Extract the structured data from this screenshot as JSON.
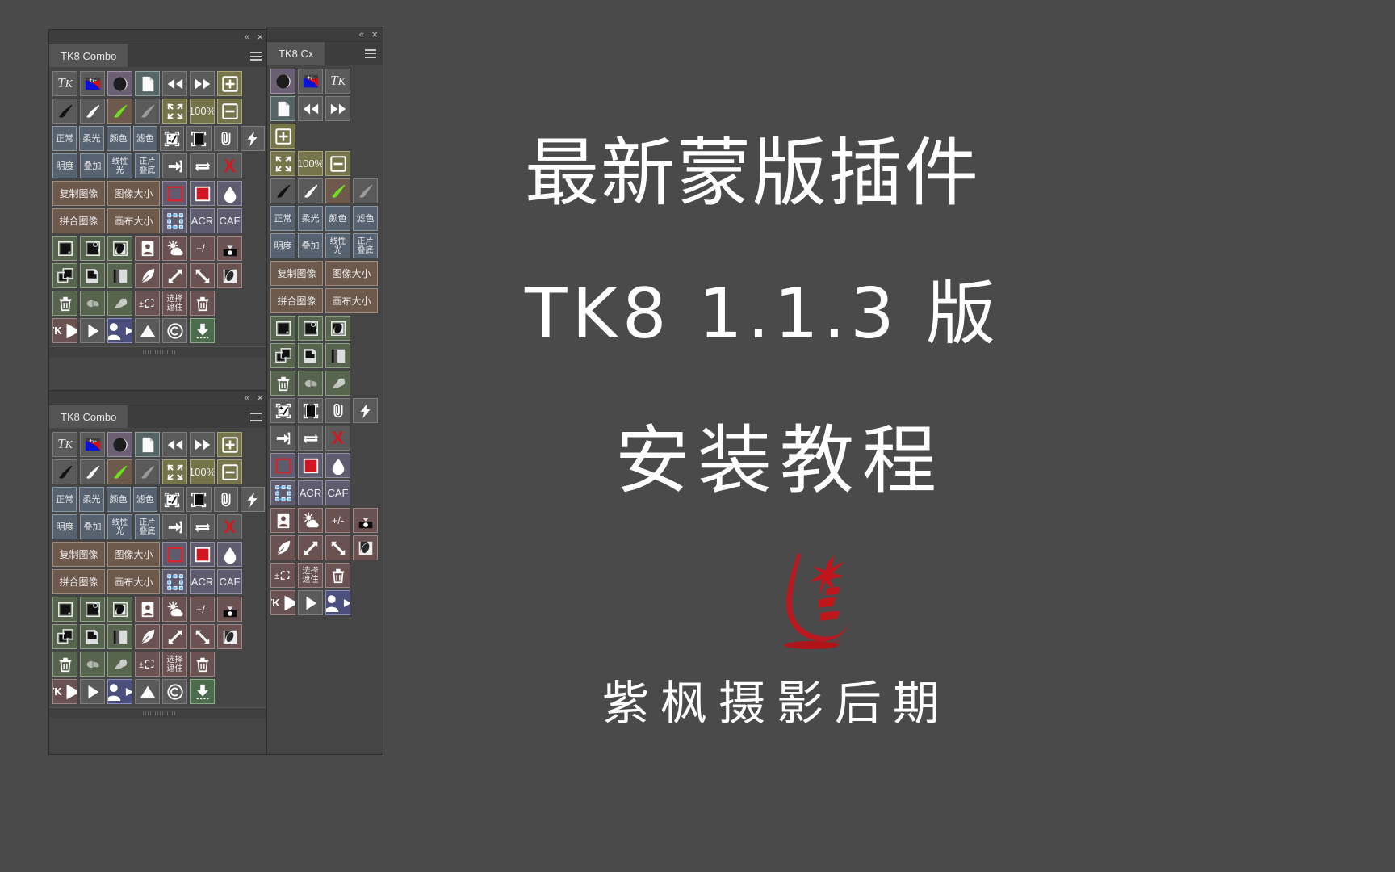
{
  "canvas": {
    "bg": "#4a4a4a"
  },
  "hero": {
    "line1": "最新蒙版插件",
    "line2": "TK8 1.1.3 版",
    "line3": "安装教程",
    "line4": "紫枫摄影后期",
    "logo_label": "紫枫摄影后期 seal",
    "logo_color": "#c0151b"
  },
  "panels": [
    {
      "id": "combo-top",
      "tab_label": "TK8 Combo",
      "collapse_label": "«",
      "close_label": "×",
      "menu_label": "panel-menu"
    },
    {
      "id": "cx",
      "tab_label": "TK8 Cx",
      "collapse_label": "«",
      "close_label": "×",
      "menu_label": "panel-menu"
    },
    {
      "id": "combo-bottom",
      "tab_label": "TK8 Combo",
      "collapse_label": "«",
      "close_label": "×",
      "menu_label": "panel-menu"
    }
  ],
  "labels": {
    "tk": "TK",
    "plusminus": "+/-",
    "zoom100": "100%",
    "normal": "正常",
    "soft_light": "柔光",
    "color": "颜色",
    "screen": "滤色",
    "luminosity": "明度",
    "overlay": "叠加",
    "linear_light": "线性光",
    "multiply": "正片叠底",
    "duplicate_image": "复制图像",
    "image_size": "图像大小",
    "flatten_image": "拼合图像",
    "canvas_size": "画布大小",
    "acr": "ACR",
    "caf": "CAF",
    "select_mask": "选择遮住",
    "plus_minus_sel": "±",
    "copyright": "©"
  },
  "combo_grid": {
    "left_rows": [
      [
        "tk-button",
        "plus-minus-color",
        "circle-half-tone",
        "duplicate-image",
        "image-size",
        "flatten-image",
        "canvas-size",
        "layer-new",
        "layer-mask",
        "layer-adjust",
        "layer-stack",
        "layer-dup",
        "layer-group",
        "trash",
        "apply-mask",
        "half-mask",
        "tk-actions"
      ],
      [
        "brush-black",
        "brush-white",
        "brush-green",
        "brush-grey"
      ]
    ],
    "right_rows": []
  },
  "buttons": {
    "row1": [
      {
        "name": "tk-logo-button",
        "label": "TK",
        "variant": "grey"
      },
      {
        "name": "plus-minus-color-button",
        "label": "+/-",
        "variant": "grey"
      },
      {
        "name": "circle-tone-button",
        "label": "",
        "variant": "purple"
      },
      {
        "name": "new-document-button",
        "label": "",
        "variant": "teal"
      },
      {
        "name": "rewind-button",
        "label": "",
        "variant": "grey"
      },
      {
        "name": "forward-button",
        "label": "",
        "variant": "grey"
      },
      {
        "name": "zoom-in-button",
        "label": "",
        "variant": "olive"
      }
    ],
    "row2": [
      {
        "name": "brush-black-button",
        "label": "",
        "variant": "grey"
      },
      {
        "name": "brush-white-button",
        "label": "",
        "variant": "grey"
      },
      {
        "name": "brush-green-button",
        "label": "",
        "variant": "brown"
      },
      {
        "name": "brush-grey-button",
        "label": "",
        "variant": "grey"
      },
      {
        "name": "fit-screen-button",
        "label": "",
        "variant": "olive"
      },
      {
        "name": "zoom-100-button",
        "label": "100%",
        "variant": "olive"
      },
      {
        "name": "zoom-out-button",
        "label": "",
        "variant": "olive"
      }
    ],
    "row3": [
      {
        "name": "blend-normal-button",
        "label": "正常",
        "variant": "blue"
      },
      {
        "name": "blend-soft-light-button",
        "label": "柔光",
        "variant": "blue"
      },
      {
        "name": "blend-color-button",
        "label": "颜色",
        "variant": "blue"
      },
      {
        "name": "blend-screen-button",
        "label": "滤色",
        "variant": "blue"
      },
      {
        "name": "levels-button",
        "label": "",
        "variant": "grey"
      },
      {
        "name": "black-fill-button",
        "label": "",
        "variant": "grey"
      },
      {
        "name": "clip-layer-button",
        "label": "",
        "variant": "grey"
      },
      {
        "name": "flash-button",
        "label": "",
        "variant": "grey"
      }
    ],
    "row4": [
      {
        "name": "blend-luminosity-button",
        "label": "明度",
        "variant": "blue"
      },
      {
        "name": "blend-overlay-button",
        "label": "叠加",
        "variant": "blue"
      },
      {
        "name": "blend-linear-light-button",
        "label": "线性光",
        "variant": "blue"
      },
      {
        "name": "blend-multiply-button",
        "label": "正片叠底",
        "variant": "blue"
      },
      {
        "name": "merge-down-button",
        "label": "",
        "variant": "grey"
      },
      {
        "name": "swap-button",
        "label": "",
        "variant": "grey"
      },
      {
        "name": "delete-x-button",
        "label": "X",
        "variant": "grey"
      }
    ],
    "row5": [
      {
        "name": "duplicate-image-button",
        "label": "复制图像",
        "variant": "brown"
      },
      {
        "name": "image-size-button",
        "label": "图像大小",
        "variant": "brown"
      },
      {
        "name": "stroke-selection-button",
        "label": "",
        "variant": "slate"
      },
      {
        "name": "fill-red-button",
        "label": "",
        "variant": "slate"
      },
      {
        "name": "water-drop-button",
        "label": "",
        "variant": "slate"
      }
    ],
    "row6": [
      {
        "name": "flatten-image-button",
        "label": "拼合图像",
        "variant": "brown"
      },
      {
        "name": "canvas-size-button",
        "label": "画布大小",
        "variant": "brown"
      },
      {
        "name": "free-transform-button",
        "label": "",
        "variant": "slate"
      },
      {
        "name": "acr-button",
        "label": "ACR",
        "variant": "slate"
      },
      {
        "name": "caf-button",
        "label": "CAF",
        "variant": "slate"
      }
    ],
    "row7": [
      {
        "name": "new-layer-button",
        "label": "",
        "variant": "green"
      },
      {
        "name": "layer-via-copy-button",
        "label": "",
        "variant": "green"
      },
      {
        "name": "layer-mask-button",
        "label": "",
        "variant": "green"
      },
      {
        "name": "portrait-button",
        "label": "",
        "variant": "maroon"
      },
      {
        "name": "weather-button",
        "label": "",
        "variant": "maroon"
      },
      {
        "name": "plus-minus-button",
        "label": "+/-",
        "variant": "maroon"
      },
      {
        "name": "mask-download-button",
        "label": "",
        "variant": "maroon"
      }
    ],
    "row8": [
      {
        "name": "duplicate-layer-button",
        "label": "",
        "variant": "green"
      },
      {
        "name": "copy-layer-button",
        "label": "",
        "variant": "green"
      },
      {
        "name": "split-layer-button",
        "label": "",
        "variant": "green"
      },
      {
        "name": "feather-button",
        "label": "",
        "variant": "maroon"
      },
      {
        "name": "expand-button",
        "label": "",
        "variant": "maroon"
      },
      {
        "name": "contract-button",
        "label": "",
        "variant": "maroon"
      },
      {
        "name": "invert-mask-button",
        "label": "",
        "variant": "maroon"
      }
    ],
    "row9": [
      {
        "name": "delete-layer-button",
        "label": "",
        "variant": "green"
      },
      {
        "name": "preview-mask-button",
        "label": "",
        "variant": "green"
      },
      {
        "name": "half-tone-button",
        "label": "",
        "variant": "green"
      },
      {
        "name": "modify-selection-button",
        "label": "±",
        "variant": "maroon"
      },
      {
        "name": "select-and-mask-button",
        "label": "选择遮住",
        "variant": "maroon"
      },
      {
        "name": "delete-selection-button",
        "label": "",
        "variant": "maroon"
      }
    ],
    "row10": [
      {
        "name": "tk-actions-button",
        "label": "TK",
        "variant": "maroon"
      },
      {
        "name": "play-action-button",
        "label": "",
        "variant": "grey"
      },
      {
        "name": "user-action-button",
        "label": "",
        "variant": "navy"
      },
      {
        "name": "triangle-button",
        "label": "",
        "variant": "grey"
      },
      {
        "name": "copyright-button",
        "label": "©",
        "variant": "grey"
      },
      {
        "name": "download-button",
        "label": "",
        "variant": "gbtn"
      }
    ]
  }
}
